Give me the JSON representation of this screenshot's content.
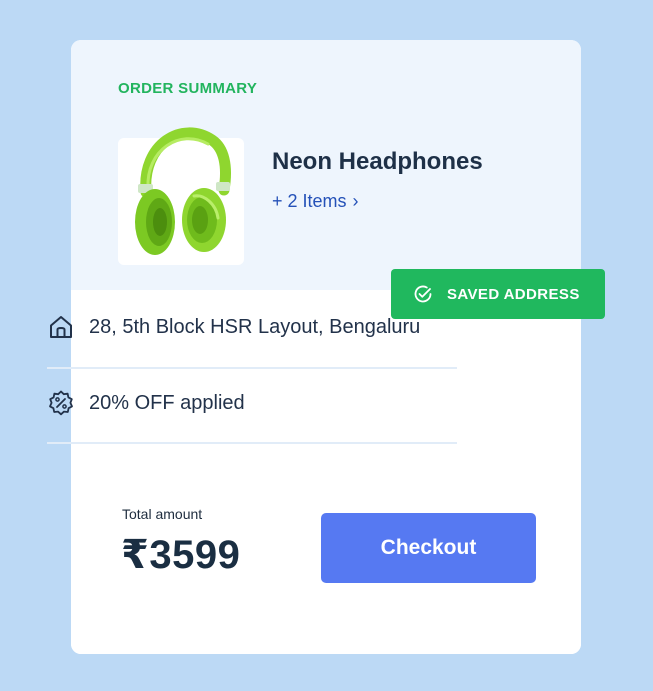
{
  "order_summary": {
    "section_label": "ORDER SUMMARY",
    "product": {
      "name": "Neon Headphones",
      "image_icon": "neon-green-headphones",
      "items_link": "+ 2 Items",
      "items_chevron": "›"
    }
  },
  "saved_address_badge": {
    "label": "SAVED ADDRESS",
    "icon": "check-circle-icon",
    "color": "#20b85e"
  },
  "details": {
    "address": {
      "icon": "home-icon",
      "text": "28, 5th Block HSR Layout, Bengaluru"
    },
    "offer": {
      "icon": "discount-badge-icon",
      "text": "20% OFF applied"
    }
  },
  "total": {
    "label": "Total amount",
    "value": "₹3599"
  },
  "checkout": {
    "label": "Checkout",
    "color": "#5679f2"
  },
  "colors": {
    "background": "#bcd9f5",
    "card": "#ffffff",
    "card_top": "#eef5fd",
    "accent_green": "#22b45e",
    "link_blue": "#2451b8",
    "text_dark": "#1e3047"
  }
}
